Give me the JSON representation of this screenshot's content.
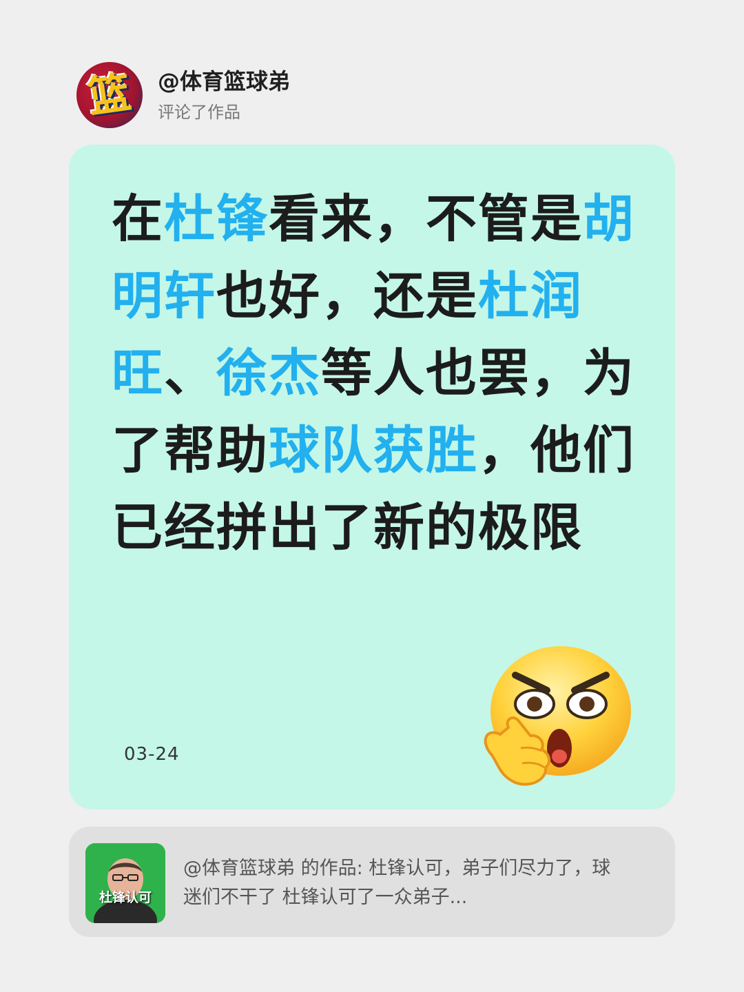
{
  "header": {
    "avatar_glyph": "篮",
    "username": "@体育篮球弟",
    "subtitle": "评论了作品"
  },
  "comment": {
    "segments": [
      {
        "text": "在",
        "hl": false
      },
      {
        "text": "杜锋",
        "hl": true
      },
      {
        "text": "看来，不管是",
        "hl": false
      },
      {
        "text": "胡明轩",
        "hl": true
      },
      {
        "text": "也好，还是",
        "hl": false
      },
      {
        "text": "杜润旺",
        "hl": true
      },
      {
        "text": "、",
        "hl": false
      },
      {
        "text": "徐杰",
        "hl": true
      },
      {
        "text": "等人也罢，为了帮助",
        "hl": false
      },
      {
        "text": "球队获胜",
        "hl": true
      },
      {
        "text": "，他们已经拼出了新的极限",
        "hl": false
      }
    ],
    "date": "03-24",
    "emoji_icon": "thinking-angry-emoji-icon",
    "highlight_color": "#22b0ef",
    "card_color": "#c4f7e7"
  },
  "reference": {
    "thumb_caption": "杜锋认可",
    "text": "@体育篮球弟 的作品: 杜锋认可，弟子们尽力了，球迷们不干了 杜锋认可了一众弟子..."
  }
}
